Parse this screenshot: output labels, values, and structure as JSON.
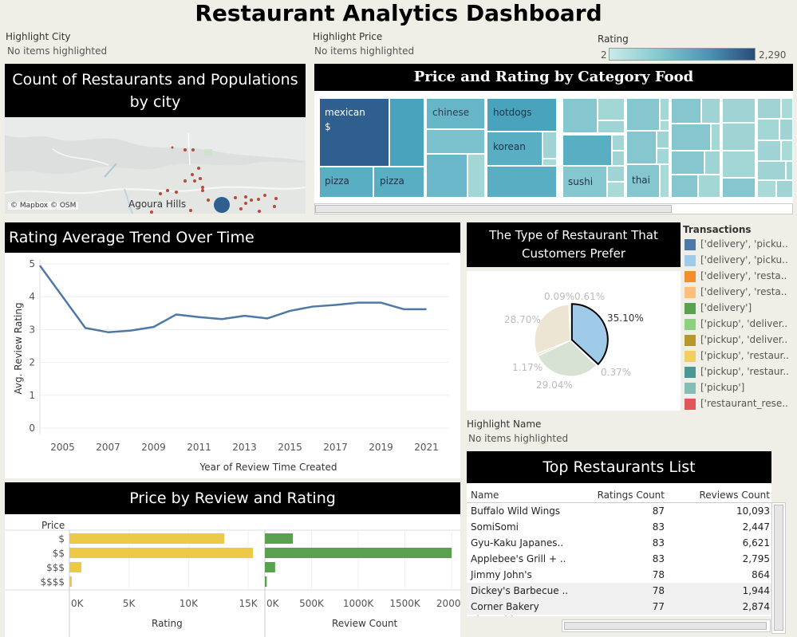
{
  "title": "Restaurant Analytics Dashboard",
  "highlight_city": {
    "label": "Highlight City",
    "value": "No items highlighted"
  },
  "highlight_price": {
    "label": "Highlight Price",
    "value": "No items highlighted"
  },
  "rating_legend": {
    "label": "Rating",
    "min": "2",
    "max": "2,290"
  },
  "map": {
    "title": "Count of Restaurants and Populations by city",
    "city_label": "Agoura Hills",
    "attribution": "© Mapbox © OSM"
  },
  "treemap": {
    "title": "Price and Rating by Category Food",
    "labels": {
      "mexican": "mexican",
      "mexican_price": "$",
      "chinese": "chinese",
      "hotdogs": "hotdogs",
      "korean": "korean",
      "pizza1": "pizza",
      "pizza2": "pizza",
      "sushi": "sushi",
      "thai": "thai"
    },
    "colors": {
      "dark": "#2e5f8f",
      "mid": "#5aaec4",
      "light": "#9fd3d4"
    }
  },
  "trend": {
    "title": "Rating Average Trend Over Time",
    "ylabel": "Avg. Review Rating",
    "xlabel": "Year of Review Time Created",
    "yticks": [
      "5",
      "4",
      "3",
      "2",
      "1",
      "0"
    ],
    "xticks": [
      "2005",
      "2007",
      "2009",
      "2011",
      "2013",
      "2015",
      "2017",
      "2019",
      "2021"
    ]
  },
  "pie": {
    "title": "The Type of Restaurant That Customers Prefer",
    "labels": {
      "a": "0.09%",
      "b": "0.61%",
      "c": "35.10%",
      "d": "28.70%",
      "e": "1.17%",
      "f": "0.37%",
      "g": "29.04%"
    }
  },
  "transactions": {
    "title": "Transactions",
    "items": [
      {
        "label": "['delivery', 'picku..",
        "color": "#4e79a7"
      },
      {
        "label": "['delivery', 'picku..",
        "color": "#a0cbe8"
      },
      {
        "label": "['delivery', 'resta..",
        "color": "#f28e2b"
      },
      {
        "label": "['delivery', 'resta..",
        "color": "#ffbe7d"
      },
      {
        "label": "['delivery']",
        "color": "#59a14f"
      },
      {
        "label": "['pickup', 'deliver..",
        "color": "#8cd17d"
      },
      {
        "label": "['pickup', 'deliver..",
        "color": "#b6992d"
      },
      {
        "label": "['pickup', 'restaur..",
        "color": "#f1ce63"
      },
      {
        "label": "['pickup', 'restaur..",
        "color": "#499894"
      },
      {
        "label": "['pickup']",
        "color": "#86bcb6"
      },
      {
        "label": "['restaurant_rese..",
        "color": "#e15759"
      }
    ]
  },
  "highlight_name": {
    "label": "Highlight Name",
    "value": "No items highlighted"
  },
  "top_list": {
    "title": "Top Restaurants List",
    "columns": [
      "Name",
      "Ratings Count",
      "Reviews Count"
    ],
    "rows": [
      {
        "name": "Buffalo Wild Wings",
        "ratings": "87",
        "reviews": "10,093"
      },
      {
        "name": "SomiSomi",
        "ratings": "83",
        "reviews": "2,447"
      },
      {
        "name": "Gyu-Kaku Japanes..",
        "ratings": "83",
        "reviews": "6,621"
      },
      {
        "name": "Applebee's Grill + ..",
        "ratings": "83",
        "reviews": "2,795"
      },
      {
        "name": "Jimmy John's",
        "ratings": "78",
        "reviews": "864"
      },
      {
        "name": "Dickey's Barbecue ..",
        "ratings": "78",
        "reviews": "1,944"
      },
      {
        "name": "Corner Bakery",
        "ratings": "77",
        "reviews": "2,874"
      }
    ]
  },
  "price_chart": {
    "title": "Price by Review and Rating",
    "price_header": "Price",
    "rating_xlabel": "Rating",
    "review_xlabel": "Review Count",
    "rating_ticks": [
      "0K",
      "5K",
      "10K",
      "15K"
    ],
    "review_ticks": [
      "0K",
      "500K",
      "1000K",
      "1500K",
      "2000K"
    ]
  },
  "chart_data": [
    {
      "type": "line",
      "title": "Rating Average Trend Over Time",
      "xlabel": "Year of Review Time Created",
      "ylabel": "Avg. Review Rating",
      "ylim": [
        0,
        5
      ],
      "xlim": [
        2004,
        2022
      ],
      "color": "#4e79a7",
      "x": [
        2004,
        2006,
        2007,
        2008,
        2009,
        2010,
        2011,
        2012,
        2013,
        2014,
        2015,
        2016,
        2017,
        2018,
        2019,
        2020,
        2021
      ],
      "y": [
        4.95,
        3.05,
        2.92,
        2.97,
        3.08,
        3.46,
        3.38,
        3.32,
        3.42,
        3.34,
        3.57,
        3.7,
        3.75,
        3.82,
        3.82,
        3.62,
        3.62
      ]
    },
    {
      "type": "pie",
      "title": "The Type of Restaurant That Customers Prefer",
      "slices": [
        {
          "label": "35.10%",
          "value": 35.1,
          "color": "#a0cbe8",
          "highlight": true
        },
        {
          "label": "0.37%",
          "value": 0.37,
          "color": "#d6e4ea"
        },
        {
          "label": "29.04%",
          "value": 29.04,
          "color": "#d8e2d4"
        },
        {
          "label": "1.17%",
          "value": 1.17,
          "color": "#efeadc"
        },
        {
          "label": "28.70%",
          "value": 28.7,
          "color": "#ece5d3"
        },
        {
          "label": "0.09%",
          "value": 0.09,
          "color": "#e6e6e6"
        },
        {
          "label": "0.61%",
          "value": 0.61,
          "color": "#dcdcdc"
        }
      ]
    },
    {
      "type": "bar",
      "title": "Price by Review and Rating",
      "categories": [
        "$",
        "$$",
        "$$$",
        "$$$$"
      ],
      "series": [
        {
          "name": "Rating",
          "values": [
            13000,
            15400,
            1000,
            200
          ],
          "color": "#edc948",
          "xlim": [
            0,
            16000
          ]
        },
        {
          "name": "Review Count",
          "values": [
            300000,
            2000000,
            110000,
            20000
          ],
          "color": "#59a14f",
          "xlim": [
            0,
            2050000
          ]
        }
      ]
    }
  ]
}
